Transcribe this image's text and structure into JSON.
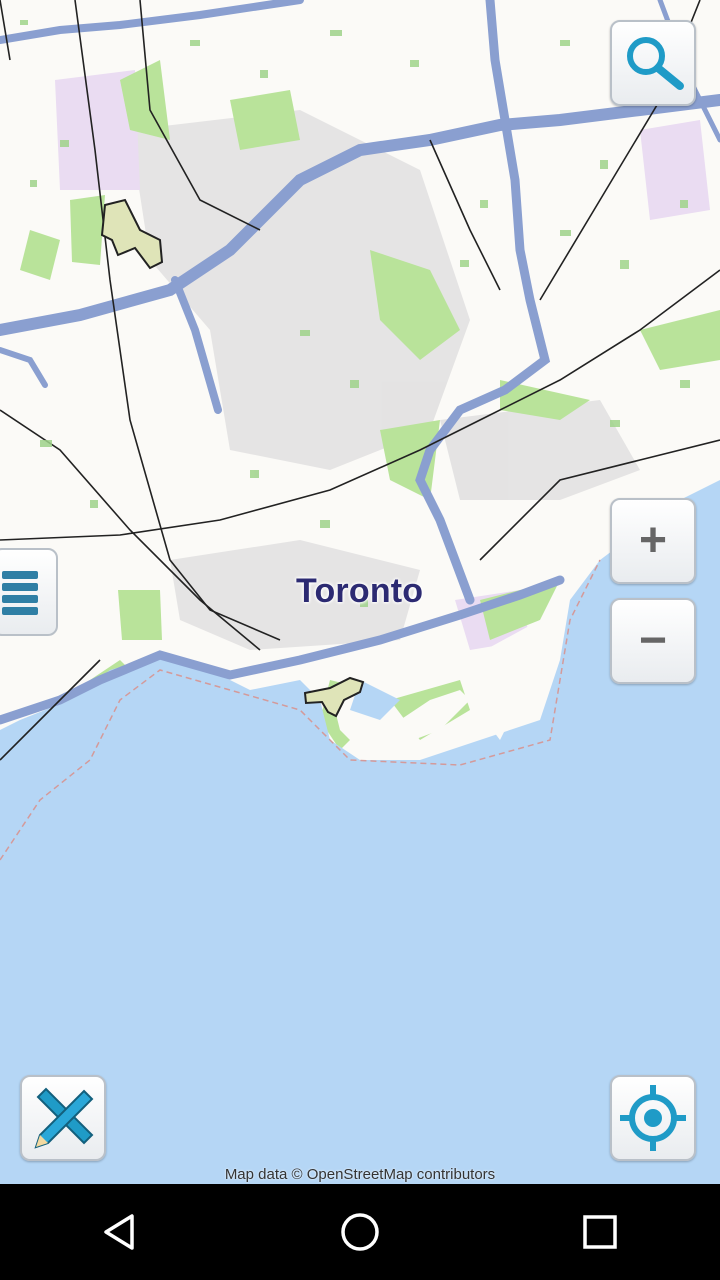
{
  "map": {
    "city_label": "Toronto",
    "attribution": "Map data © OpenStreetMap contributors",
    "colors": {
      "water": "#b5d6f5",
      "land": "#fbfaf7",
      "park": "#b9e39a",
      "highway": "#8a9fd0",
      "rail": "#222222",
      "urban": "#dcdcdc"
    }
  },
  "controls": {
    "search": "search-icon",
    "zoom_in": "+",
    "zoom_out": "−",
    "layers": "layers-icon",
    "measure": "ruler-pencil-icon",
    "locate": "locate-icon"
  },
  "navbar": {
    "back": "back-triangle-icon",
    "home": "home-circle-icon",
    "recents": "recents-square-icon"
  }
}
